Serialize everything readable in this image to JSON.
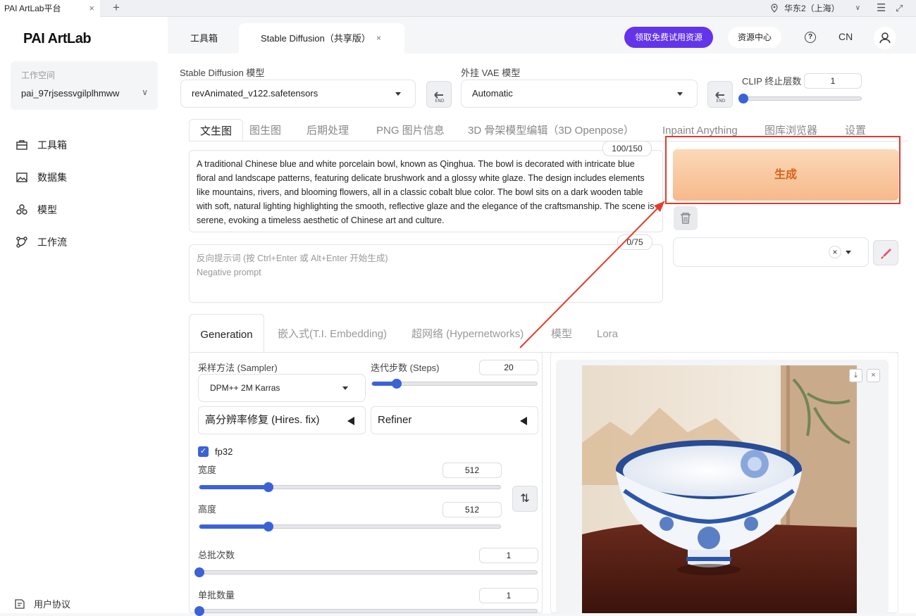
{
  "browser": {
    "tab_title": "PAI ArtLab平台",
    "region": "华东2（上海）"
  },
  "sidebar": {
    "logo": "PAI ArtLab",
    "workspace_label": "工作空间",
    "workspace_value": "pai_97rjsessvgilplhmww",
    "items": [
      {
        "label": "工具箱",
        "icon": "toolbox-icon"
      },
      {
        "label": "数据集",
        "icon": "image-icon"
      },
      {
        "label": "模型",
        "icon": "cubes-icon"
      },
      {
        "label": "工作流",
        "icon": "workflow-icon"
      }
    ],
    "agreement": "用户协议"
  },
  "header": {
    "tabs": [
      {
        "label": "工具箱"
      },
      {
        "label": "Stable Diffusion（共享版）"
      }
    ],
    "promo_button": "领取免费试用资源",
    "resource_button": "资源中心",
    "lang": "CN"
  },
  "models": {
    "sd_label": "Stable Diffusion 模型",
    "sd_value": "revAnimated_v122.safetensors",
    "vae_label": "外挂 VAE 模型",
    "vae_value": "Automatic",
    "clip_label": "CLIP 终止层数",
    "clip_value": "1",
    "clip_fraction": 0
  },
  "main_tabs": [
    "文生图",
    "图生图",
    "后期处理",
    "PNG 图片信息",
    "3D 骨架模型编辑（3D Openpose）",
    "Inpaint Anything",
    "图库浏览器",
    "设置"
  ],
  "prompt": {
    "text": "A traditional Chinese blue and white porcelain bowl, known as Qinghua. The bowl is decorated with intricate blue floral and landscape patterns, featuring delicate brushwork and a glossy white glaze. The design includes elements like mountains, rivers, and blooming flowers, all in a classic cobalt blue color. The bowl sits on a dark wooden table with soft, natural lighting highlighting the smooth, reflective glaze and the elegance of the craftsmanship. The scene is serene, evoking a timeless aesthetic of Chinese art and culture.",
    "counter": "100/150",
    "neg_placeholder_1": "反向提示词 (按 Ctrl+Enter 或 Alt+Enter 开始生成)",
    "neg_placeholder_2": "Negative prompt",
    "neg_counter": "0/75"
  },
  "generate_label": "生成",
  "sub_tabs": [
    "Generation",
    "嵌入式(T.I. Embedding)",
    "超网络 (Hypernetworks)",
    "模型",
    "Lora"
  ],
  "generation": {
    "sampler_label": "采样方法 (Sampler)",
    "sampler_value": "DPM++ 2M Karras",
    "steps_label": "迭代步数 (Steps)",
    "steps_value": "20",
    "steps_fraction": 0.15,
    "hires_label": "高分辨率修复 (Hires. fix)",
    "refiner_label": "Refiner",
    "fp32_label": "fp32",
    "width_label": "宽度",
    "width_value": "512",
    "width_fraction": 0.23,
    "height_label": "高度",
    "height_value": "512",
    "height_fraction": 0.23,
    "batch_count_label": "总批次数",
    "batch_count_value": "1",
    "batch_count_fraction": 0,
    "batch_size_label": "单批数量",
    "batch_size_value": "1",
    "batch_size_fraction": 0
  },
  "colors": {
    "accent": "#6434ea",
    "slider": "#3b62d6",
    "generate_text": "#d9621b",
    "highlight": "#e53a2b"
  }
}
